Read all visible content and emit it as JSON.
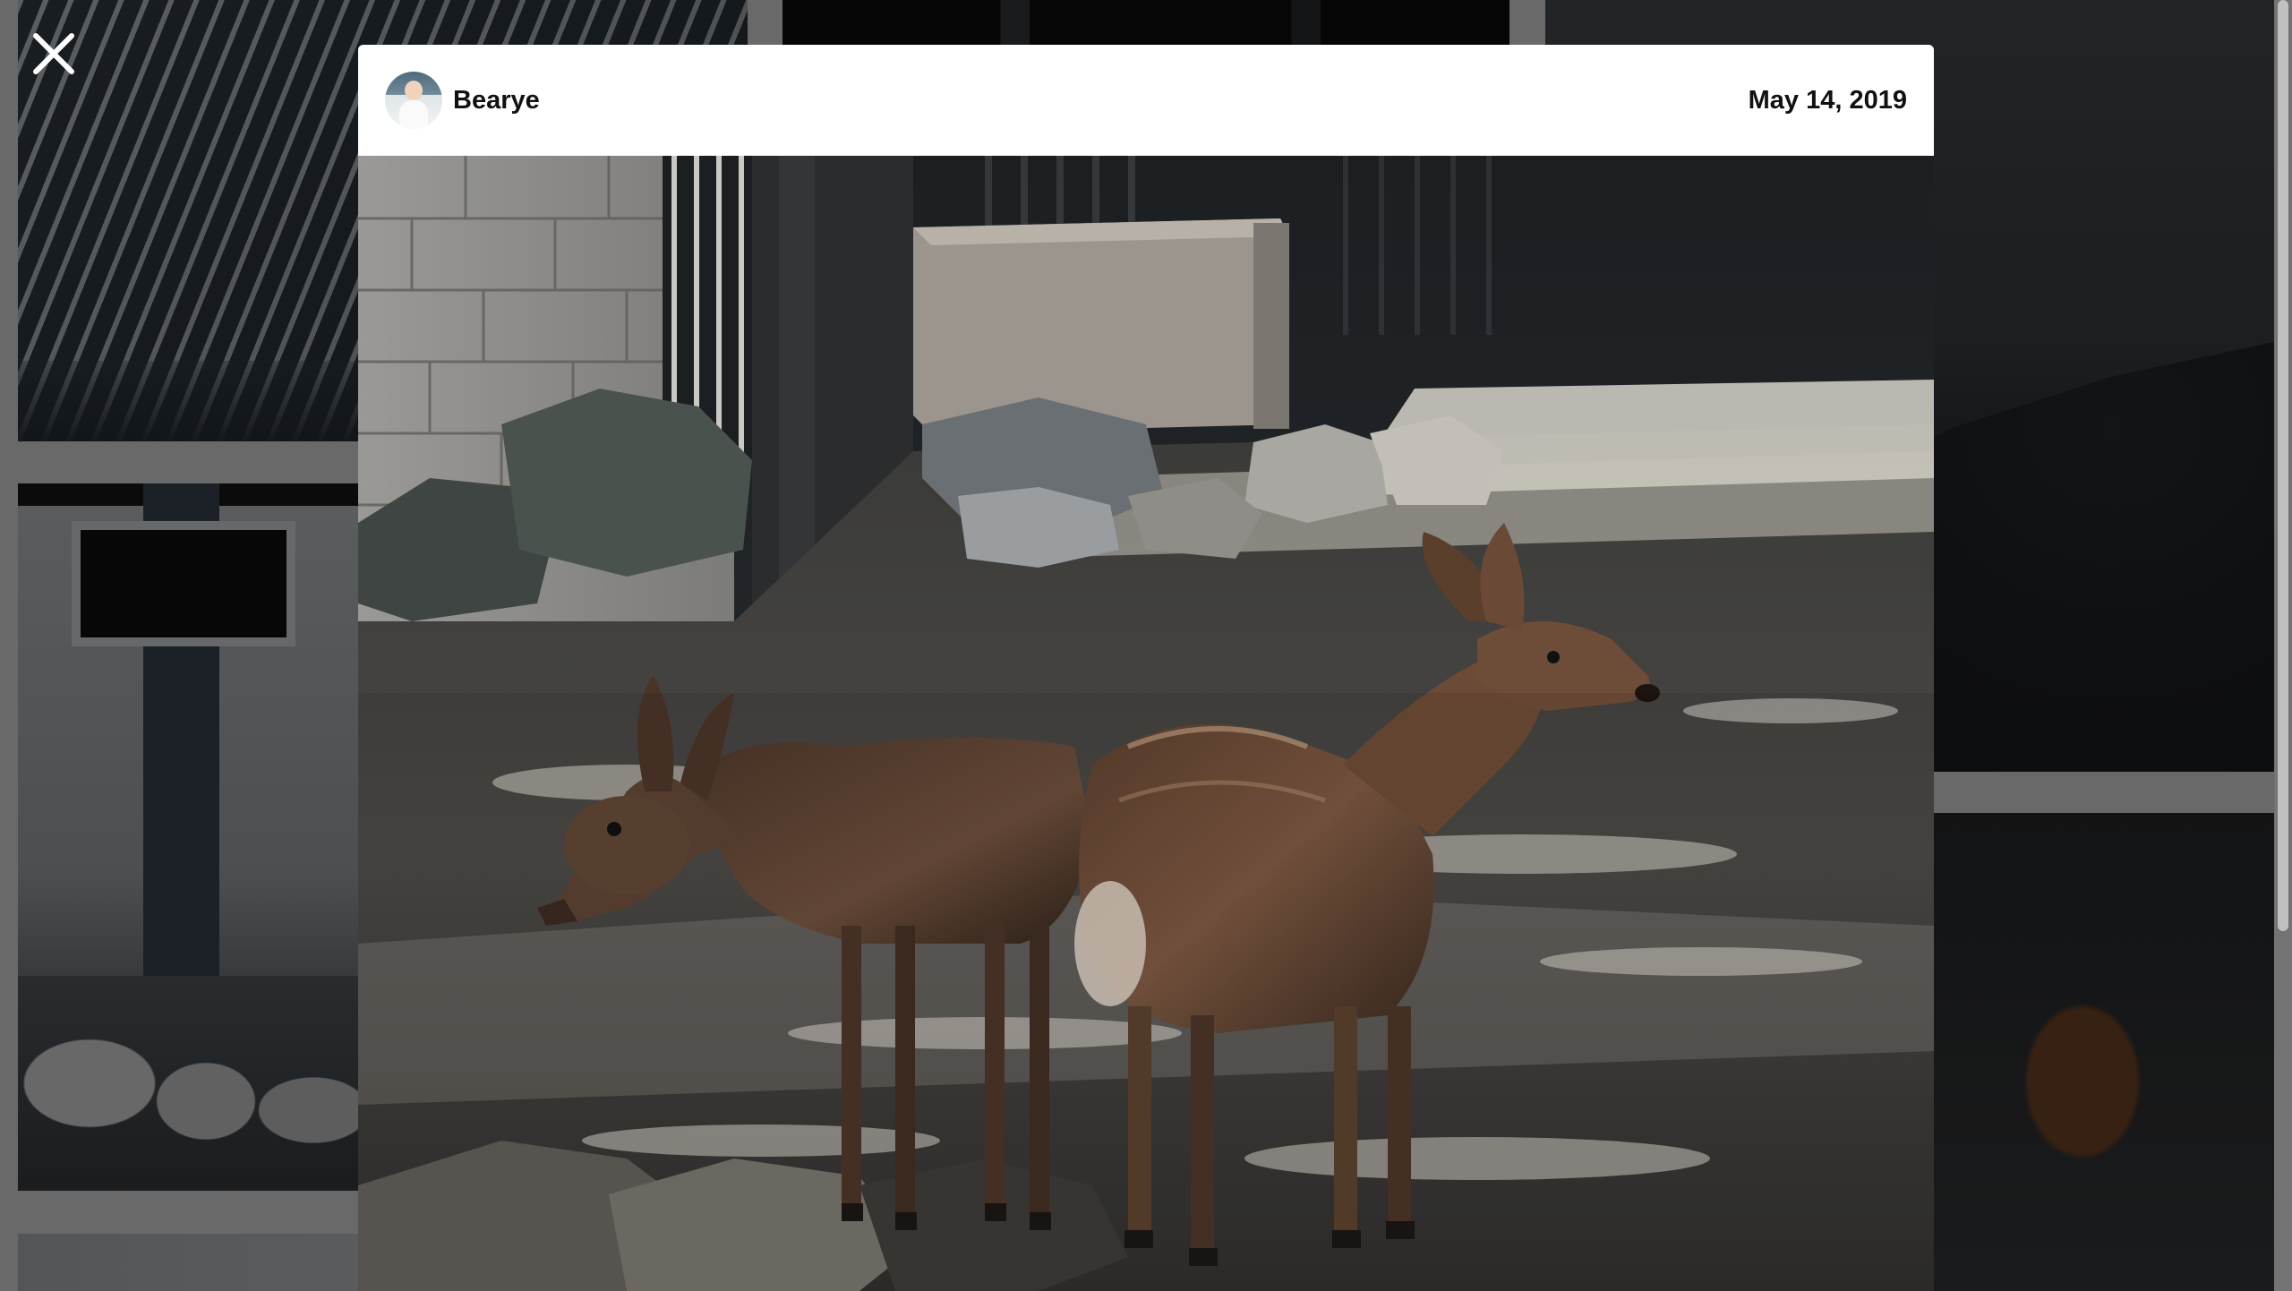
{
  "modal": {
    "author_name": "Bearye",
    "date": "May 14, 2019"
  },
  "controls": {
    "close_icon": "close-icon"
  },
  "photo": {
    "subject": "deer",
    "palette": {
      "shadow": "#1e2326",
      "stone": "#b9b7b2",
      "fur": "#6b4a36",
      "ground_light": "#c8c4bd"
    }
  }
}
